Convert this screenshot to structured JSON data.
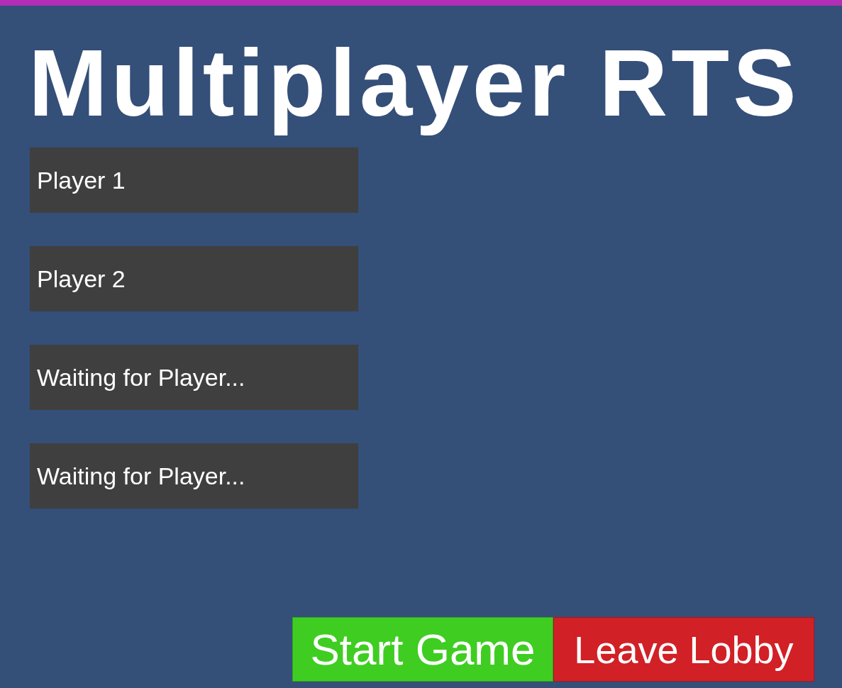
{
  "title": "Multiplayer RTS",
  "player_slots": [
    {
      "label": "Player 1"
    },
    {
      "label": "Player 2"
    },
    {
      "label": "Waiting for Player..."
    },
    {
      "label": "Waiting for Player..."
    }
  ],
  "buttons": [
    {
      "label": "Start Game",
      "kind": "start"
    },
    {
      "label": "Leave Lobby",
      "kind": "leave"
    }
  ]
}
